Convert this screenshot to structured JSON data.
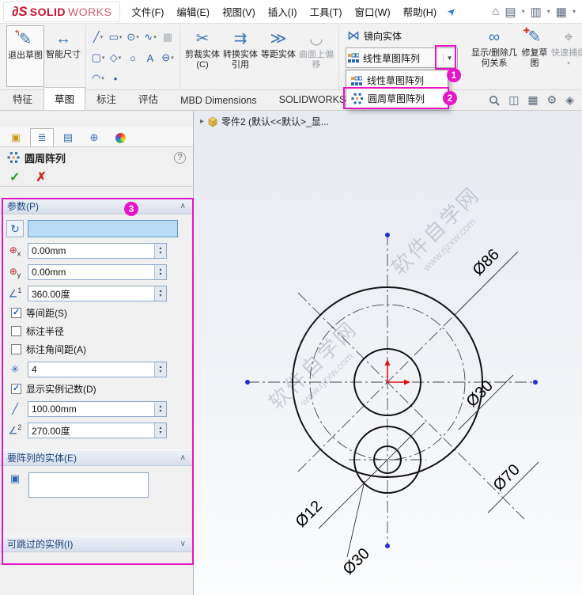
{
  "annotations": {
    "step1": "1",
    "step2": "2",
    "step3": "3"
  },
  "icons": {
    "caret": "▾",
    "chev_up": "∧",
    "chev_down": "∨",
    "check": "✓",
    "cancel": "✗",
    "help": "?",
    "expand": "▸",
    "pin": "➤",
    "home": "⌂",
    "doc_new": "▤",
    "doc_open": "▥",
    "save": "▦",
    "exit_sketch": "✎",
    "exit_arrow": "↰",
    "smart_dim": "↔",
    "trim": "✂",
    "convert": "⇉",
    "offset": "≫",
    "surface_offset": "◡",
    "mirror": "⋈",
    "relations": "∞",
    "repair": "✎",
    "repair_plus": "✚",
    "quick_snap": "⌖",
    "line": "╱",
    "rect": "▭",
    "circle": "⊙",
    "spline": "∿",
    "grid": "▦",
    "slot": "▢",
    "polygon": "◇",
    "ellipse": "○",
    "text_tool": "A",
    "arc": "◠",
    "point": "•",
    "trim_small": "⊖",
    "reverse": "↻",
    "coord_point": "⊕",
    "sub_x": "x",
    "sub_y": "y",
    "angle": "∠",
    "sup1": "1",
    "sup2": "2",
    "count": "✳",
    "radius": "╱",
    "seed": "▣",
    "spin_up": "▴",
    "spin_down": "▾",
    "ptab1": "▣",
    "ptab2": "≣",
    "ptab3": "▤",
    "ptab4": "⊕",
    "hud1": "◫",
    "hud2": "▦",
    "hud3": "⚙",
    "hud4": "◈"
  },
  "titlebar": {
    "logo_ds": "∂S",
    "logo_solid": "SOLID",
    "logo_works": "WORKS",
    "menus": [
      "文件(F)",
      "编辑(E)",
      "视图(V)",
      "插入(I)",
      "工具(T)",
      "窗口(W)",
      "帮助(H)"
    ]
  },
  "ribbon": {
    "exit_sketch": "退出草图",
    "smart_dimension": "智能尺寸",
    "trim": "剪裁实体(C)",
    "convert": "转换实体引用",
    "offset": "等距实体",
    "surface_offset": "曲面上偏移",
    "mirror": "镜向实体",
    "linear_pattern": "线性草图阵列",
    "display_relations": "显示/删除几何关系",
    "repair": "修复草图",
    "quick_snap": "快速捕捉"
  },
  "pattern_menu": {
    "items": [
      {
        "label": "线性草图阵列"
      },
      {
        "label": "圆周草图阵列"
      }
    ]
  },
  "tabs": {
    "items": [
      "特征",
      "草图",
      "标注",
      "评估",
      "MBD Dimensions",
      "SOLIDWORKS 插件"
    ]
  },
  "panel": {
    "title": "圆周阵列",
    "sections": {
      "params": "参数(P)",
      "entities": "要阵列的实体(E)",
      "skip": "可跳过的实例(I)"
    },
    "fields": {
      "direction": "",
      "center_x": "0.00mm",
      "center_y": "0.00mm",
      "total_angle": "360.00度",
      "count": "4",
      "radius": "100.00mm",
      "arc_angle": "270.00度"
    },
    "checkboxes": {
      "equal_spacing": {
        "label": "等间距(S)",
        "checked": true
      },
      "dim_radius": {
        "label": "标注半径",
        "checked": false
      },
      "dim_angular": {
        "label": "标注角间距(A)",
        "checked": false
      },
      "show_count": {
        "label": "显示实例记数(D)",
        "checked": true
      }
    }
  },
  "graphics": {
    "tree_item": "零件2 (默认<<默认>_显...",
    "watermark": {
      "line1": "软件自学网",
      "line2": "www.rjzxw.com"
    },
    "dimensions": {
      "outer": "Ø86",
      "center_hole": "Ø30",
      "bolt_circle": "Ø70",
      "small_hole": "Ø12",
      "bottom_hole": "Ø30"
    }
  }
}
